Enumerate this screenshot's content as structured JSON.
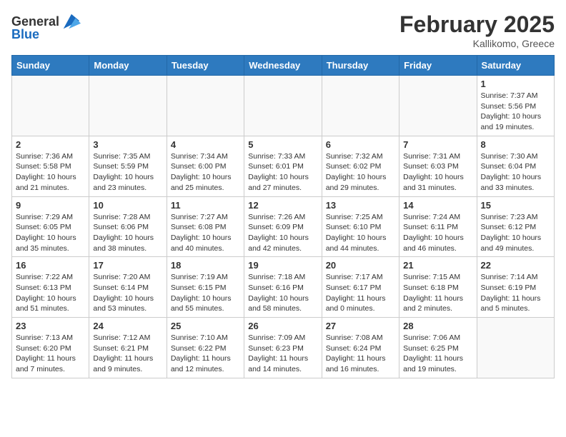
{
  "header": {
    "logo_general": "General",
    "logo_blue": "Blue",
    "month_year": "February 2025",
    "location": "Kallikomo, Greece"
  },
  "days_of_week": [
    "Sunday",
    "Monday",
    "Tuesday",
    "Wednesday",
    "Thursday",
    "Friday",
    "Saturday"
  ],
  "weeks": [
    [
      {
        "day": "",
        "info": ""
      },
      {
        "day": "",
        "info": ""
      },
      {
        "day": "",
        "info": ""
      },
      {
        "day": "",
        "info": ""
      },
      {
        "day": "",
        "info": ""
      },
      {
        "day": "",
        "info": ""
      },
      {
        "day": "1",
        "info": "Sunrise: 7:37 AM\nSunset: 5:56 PM\nDaylight: 10 hours and 19 minutes."
      }
    ],
    [
      {
        "day": "2",
        "info": "Sunrise: 7:36 AM\nSunset: 5:58 PM\nDaylight: 10 hours and 21 minutes."
      },
      {
        "day": "3",
        "info": "Sunrise: 7:35 AM\nSunset: 5:59 PM\nDaylight: 10 hours and 23 minutes."
      },
      {
        "day": "4",
        "info": "Sunrise: 7:34 AM\nSunset: 6:00 PM\nDaylight: 10 hours and 25 minutes."
      },
      {
        "day": "5",
        "info": "Sunrise: 7:33 AM\nSunset: 6:01 PM\nDaylight: 10 hours and 27 minutes."
      },
      {
        "day": "6",
        "info": "Sunrise: 7:32 AM\nSunset: 6:02 PM\nDaylight: 10 hours and 29 minutes."
      },
      {
        "day": "7",
        "info": "Sunrise: 7:31 AM\nSunset: 6:03 PM\nDaylight: 10 hours and 31 minutes."
      },
      {
        "day": "8",
        "info": "Sunrise: 7:30 AM\nSunset: 6:04 PM\nDaylight: 10 hours and 33 minutes."
      }
    ],
    [
      {
        "day": "9",
        "info": "Sunrise: 7:29 AM\nSunset: 6:05 PM\nDaylight: 10 hours and 35 minutes."
      },
      {
        "day": "10",
        "info": "Sunrise: 7:28 AM\nSunset: 6:06 PM\nDaylight: 10 hours and 38 minutes."
      },
      {
        "day": "11",
        "info": "Sunrise: 7:27 AM\nSunset: 6:08 PM\nDaylight: 10 hours and 40 minutes."
      },
      {
        "day": "12",
        "info": "Sunrise: 7:26 AM\nSunset: 6:09 PM\nDaylight: 10 hours and 42 minutes."
      },
      {
        "day": "13",
        "info": "Sunrise: 7:25 AM\nSunset: 6:10 PM\nDaylight: 10 hours and 44 minutes."
      },
      {
        "day": "14",
        "info": "Sunrise: 7:24 AM\nSunset: 6:11 PM\nDaylight: 10 hours and 46 minutes."
      },
      {
        "day": "15",
        "info": "Sunrise: 7:23 AM\nSunset: 6:12 PM\nDaylight: 10 hours and 49 minutes."
      }
    ],
    [
      {
        "day": "16",
        "info": "Sunrise: 7:22 AM\nSunset: 6:13 PM\nDaylight: 10 hours and 51 minutes."
      },
      {
        "day": "17",
        "info": "Sunrise: 7:20 AM\nSunset: 6:14 PM\nDaylight: 10 hours and 53 minutes."
      },
      {
        "day": "18",
        "info": "Sunrise: 7:19 AM\nSunset: 6:15 PM\nDaylight: 10 hours and 55 minutes."
      },
      {
        "day": "19",
        "info": "Sunrise: 7:18 AM\nSunset: 6:16 PM\nDaylight: 10 hours and 58 minutes."
      },
      {
        "day": "20",
        "info": "Sunrise: 7:17 AM\nSunset: 6:17 PM\nDaylight: 11 hours and 0 minutes."
      },
      {
        "day": "21",
        "info": "Sunrise: 7:15 AM\nSunset: 6:18 PM\nDaylight: 11 hours and 2 minutes."
      },
      {
        "day": "22",
        "info": "Sunrise: 7:14 AM\nSunset: 6:19 PM\nDaylight: 11 hours and 5 minutes."
      }
    ],
    [
      {
        "day": "23",
        "info": "Sunrise: 7:13 AM\nSunset: 6:20 PM\nDaylight: 11 hours and 7 minutes."
      },
      {
        "day": "24",
        "info": "Sunrise: 7:12 AM\nSunset: 6:21 PM\nDaylight: 11 hours and 9 minutes."
      },
      {
        "day": "25",
        "info": "Sunrise: 7:10 AM\nSunset: 6:22 PM\nDaylight: 11 hours and 12 minutes."
      },
      {
        "day": "26",
        "info": "Sunrise: 7:09 AM\nSunset: 6:23 PM\nDaylight: 11 hours and 14 minutes."
      },
      {
        "day": "27",
        "info": "Sunrise: 7:08 AM\nSunset: 6:24 PM\nDaylight: 11 hours and 16 minutes."
      },
      {
        "day": "28",
        "info": "Sunrise: 7:06 AM\nSunset: 6:25 PM\nDaylight: 11 hours and 19 minutes."
      },
      {
        "day": "",
        "info": ""
      }
    ]
  ]
}
